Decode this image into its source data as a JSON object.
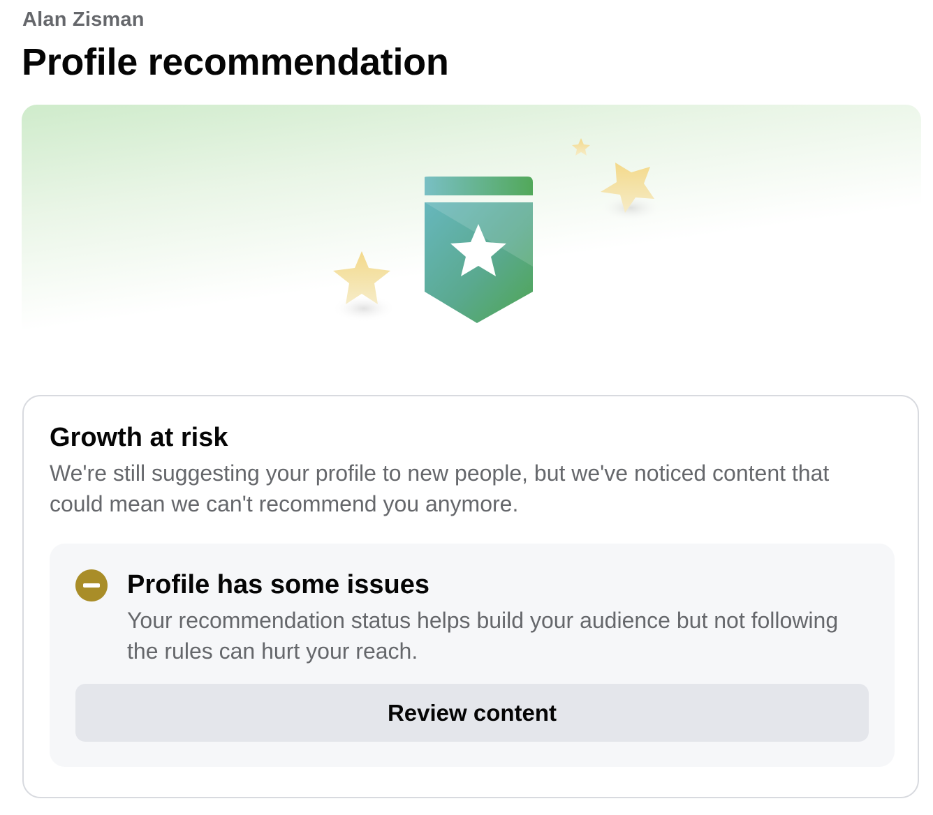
{
  "header": {
    "account_name": "Alan Zisman",
    "page_title": "Profile recommendation"
  },
  "hero": {
    "badge_icon": "ribbon-star-badge-icon",
    "decor_icons": [
      "small-star-icon",
      "large-star-icon",
      "left-star-icon"
    ],
    "colors": {
      "badge_teal": "#5fb4b8",
      "badge_green": "#52a85a",
      "star_gold": "#f2dd96",
      "hero_tint": "#cceac8"
    }
  },
  "status_card": {
    "title": "Growth at risk",
    "description": "We're still suggesting your profile to new people, but we've noticed content that could mean we can't recommend you anymore."
  },
  "issue_panel": {
    "icon": "minus-circle-icon",
    "icon_color": "#a98d28",
    "title": "Profile has some issues",
    "description": "Your recommendation status helps build your audience but not following the rules can hurt your reach.",
    "button_label": "Review content"
  }
}
